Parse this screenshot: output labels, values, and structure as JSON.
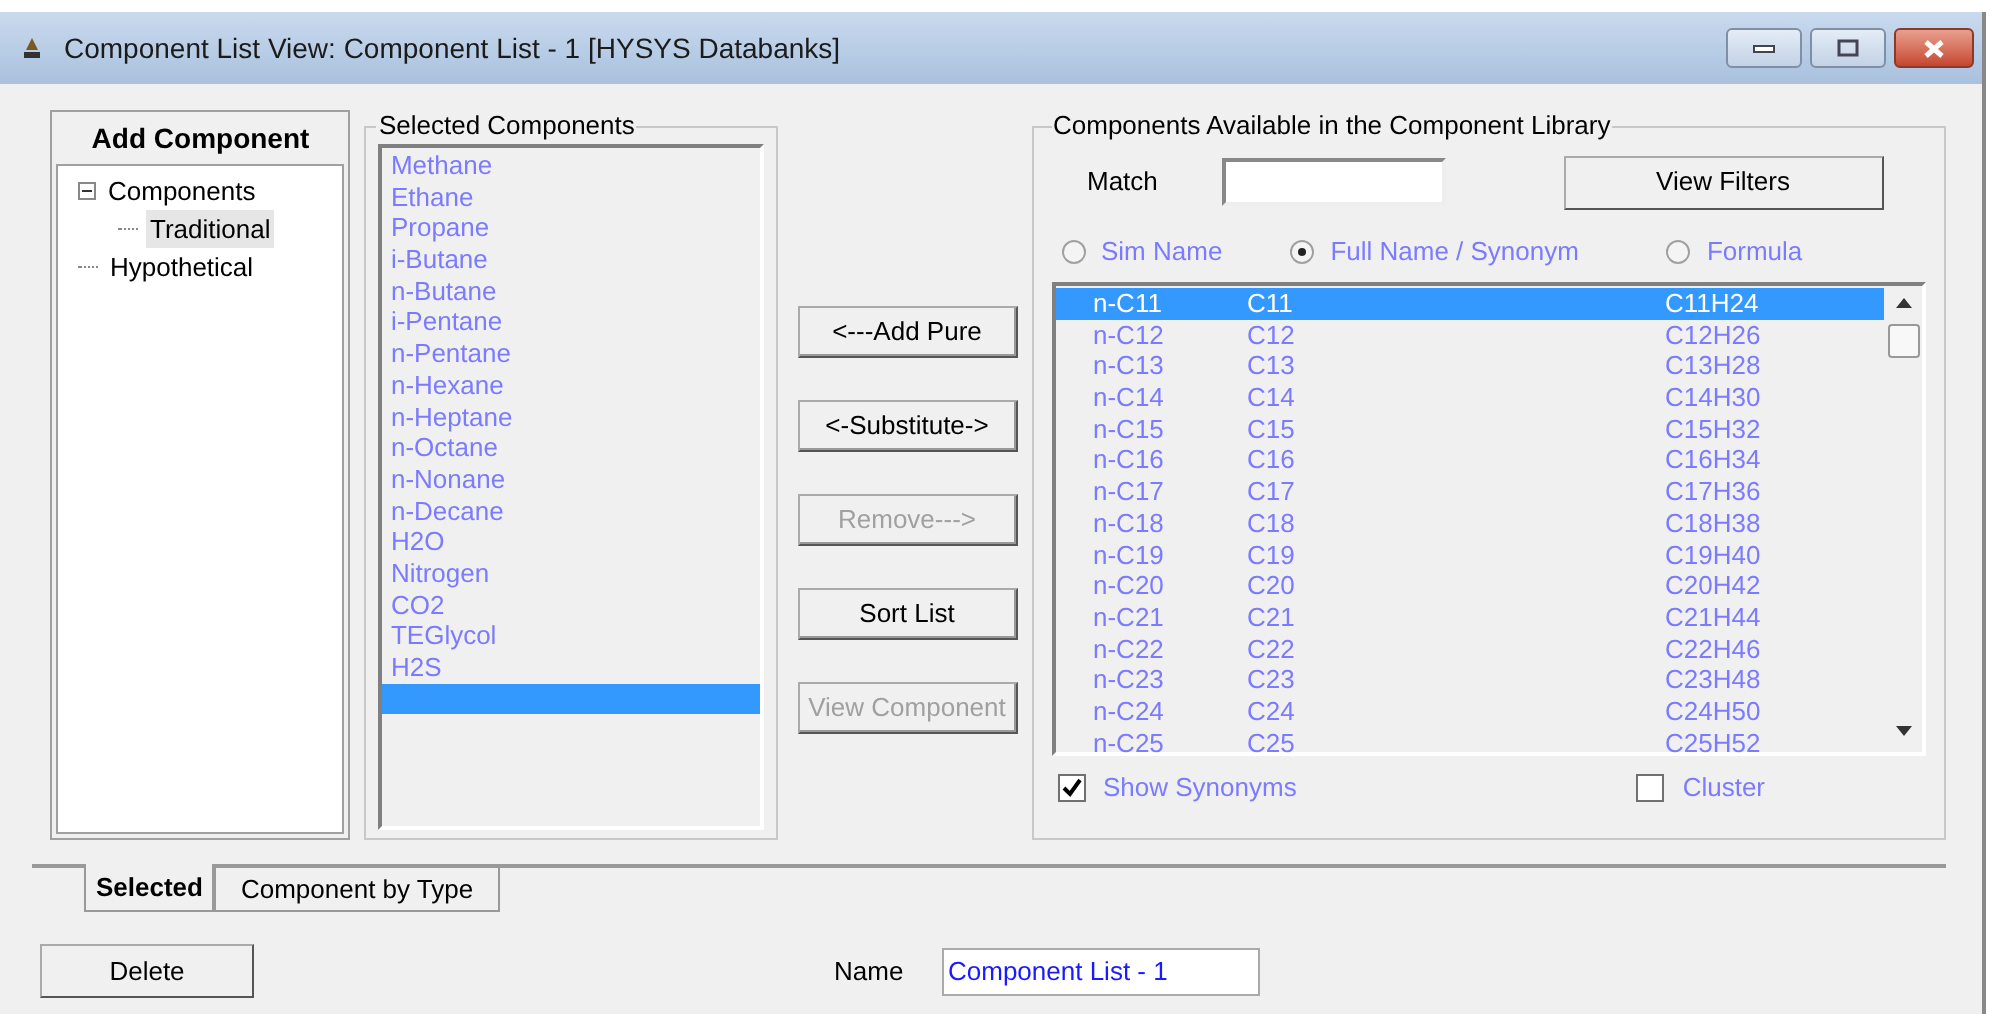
{
  "window": {
    "title": "Component List View: Component List - 1 [HYSYS Databanks]"
  },
  "add_component": {
    "title": "Add Component",
    "tree": [
      {
        "label": "Components",
        "expanded": true,
        "selected": false,
        "children": [
          {
            "label": "Traditional",
            "selected": true
          }
        ]
      },
      {
        "label": "Hypothetical",
        "selected": false
      }
    ]
  },
  "selected_components": {
    "title": "Selected Components",
    "items": [
      "Methane",
      "Ethane",
      "Propane",
      "i-Butane",
      "n-Butane",
      "i-Pentane",
      "n-Pentane",
      "n-Hexane",
      "n-Heptane",
      "n-Octane",
      "n-Nonane",
      "n-Decane",
      "H2O",
      "Nitrogen",
      "CO2",
      "TEGlycol",
      "H2S"
    ],
    "blank_row_selected": true
  },
  "actions": [
    {
      "label": "<---Add Pure",
      "disabled": false
    },
    {
      "label": "<-Substitute->",
      "disabled": false
    },
    {
      "label": "Remove--->",
      "disabled": true
    },
    {
      "label": "Sort List",
      "disabled": false
    },
    {
      "label": "View Component",
      "disabled": true
    }
  ],
  "library": {
    "title": "Components Available in the Component Library",
    "match_label": "Match",
    "view_filters": "View Filters",
    "options": [
      {
        "label": "Sim Name",
        "selected": false
      },
      {
        "label": "Full Name / Synonym",
        "selected": true
      },
      {
        "label": "Formula",
        "selected": false
      }
    ],
    "rows": [
      {
        "name": "n-C11",
        "synonym": "C11",
        "formula": "C11H24",
        "selected": true
      },
      {
        "name": "n-C12",
        "synonym": "C12",
        "formula": "C12H26",
        "selected": false
      },
      {
        "name": "n-C13",
        "synonym": "C13",
        "formula": "C13H28",
        "selected": false
      },
      {
        "name": "n-C14",
        "synonym": "C14",
        "formula": "C14H30",
        "selected": false
      },
      {
        "name": "n-C15",
        "synonym": "C15",
        "formula": "C15H32",
        "selected": false
      },
      {
        "name": "n-C16",
        "synonym": "C16",
        "formula": "C16H34",
        "selected": false
      },
      {
        "name": "n-C17",
        "synonym": "C17",
        "formula": "C17H36",
        "selected": false
      },
      {
        "name": "n-C18",
        "synonym": "C18",
        "formula": "C18H38",
        "selected": false
      },
      {
        "name": "n-C19",
        "synonym": "C19",
        "formula": "C19H40",
        "selected": false
      },
      {
        "name": "n-C20",
        "synonym": "C20",
        "formula": "C20H42",
        "selected": false
      },
      {
        "name": "n-C21",
        "synonym": "C21",
        "formula": "C21H44",
        "selected": false
      },
      {
        "name": "n-C22",
        "synonym": "C22",
        "formula": "C22H46",
        "selected": false
      },
      {
        "name": "n-C23",
        "synonym": "C23",
        "formula": "C23H48",
        "selected": false
      },
      {
        "name": "n-C24",
        "synonym": "C24",
        "formula": "C24H50",
        "selected": false
      },
      {
        "name": "n-C25",
        "synonym": "C25",
        "formula": "C25H52",
        "selected": false
      }
    ],
    "checkboxes": [
      {
        "label": "Show Synonyms",
        "checked": true
      },
      {
        "label": "Cluster",
        "checked": false
      }
    ]
  },
  "tabs": [
    {
      "label": "Selected",
      "selected": true
    },
    {
      "label": "Component by Type",
      "selected": false
    }
  ],
  "delete_button": "Delete",
  "name_field": {
    "label": "Name",
    "value": "Component List - 1"
  }
}
